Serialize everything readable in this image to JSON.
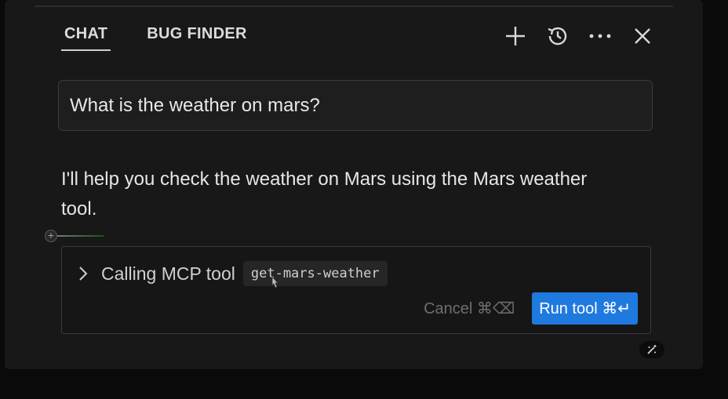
{
  "tabs": [
    {
      "label": "CHAT",
      "active": true
    },
    {
      "label": "BUG FINDER",
      "active": false
    }
  ],
  "toolbar": {
    "icons": [
      "plus-icon",
      "history-icon",
      "more-icon",
      "close-icon"
    ]
  },
  "query": {
    "text": "What is the weather on mars?"
  },
  "reply": {
    "text": "I'll help you check the weather on Mars using the Mars weather tool."
  },
  "tool_call": {
    "label": "Calling MCP tool",
    "tool_name": "get-mars-weather",
    "cancel_label": "Cancel ⌘⌫",
    "run_label": "Run tool ⌘↵"
  },
  "colors": {
    "background": "#181818",
    "accent": "#1f7ae0",
    "text": "#e4e4e4"
  }
}
